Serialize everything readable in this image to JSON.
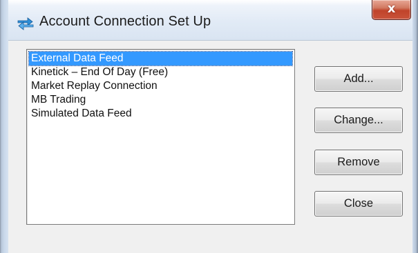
{
  "window": {
    "title": "Account Connection Set Up",
    "close_label": "x"
  },
  "connections": [
    {
      "label": "External Data Feed",
      "selected": true
    },
    {
      "label": "Kinetick – End Of Day (Free)",
      "selected": false
    },
    {
      "label": "Market Replay Connection",
      "selected": false
    },
    {
      "label": "MB Trading",
      "selected": false
    },
    {
      "label": "Simulated Data Feed",
      "selected": false
    }
  ],
  "buttons": {
    "add": "Add...",
    "change": "Change...",
    "remove": "Remove",
    "close": "Close"
  },
  "icons": {
    "app": "connection-arrows-icon",
    "close": "close-icon"
  },
  "colors": {
    "selection": "#3399ff",
    "close_button": "#c9533a"
  }
}
